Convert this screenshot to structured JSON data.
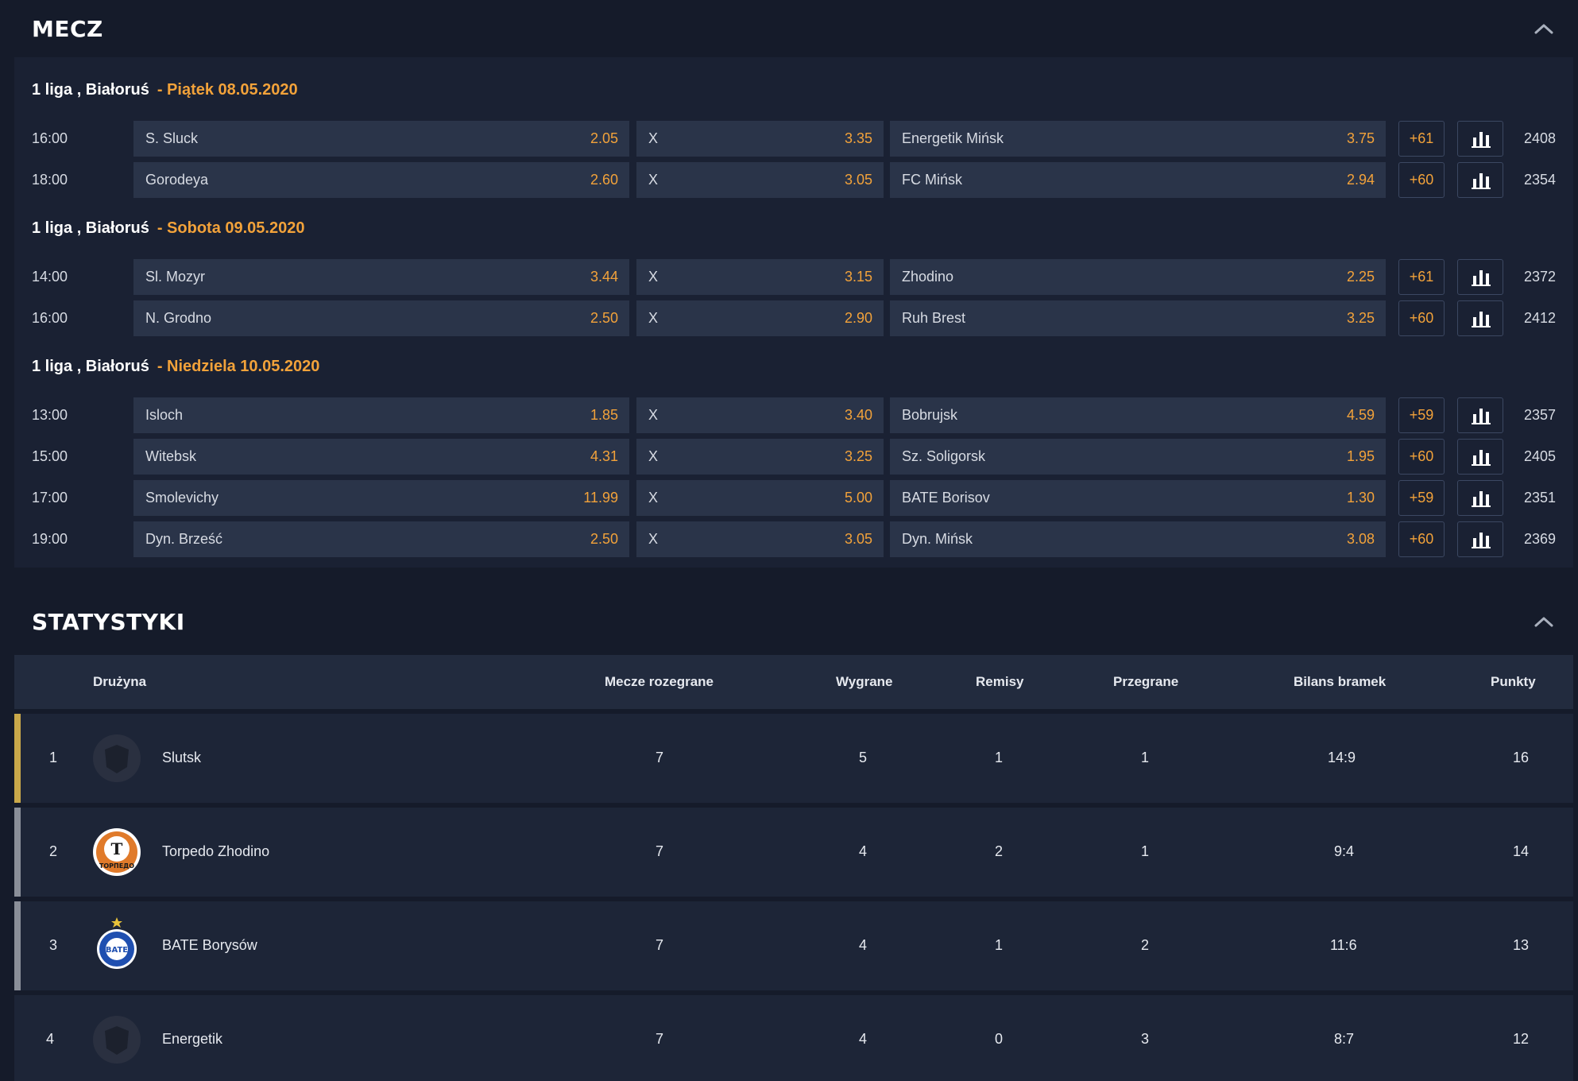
{
  "sections": {
    "match_title": "MECZ",
    "stats_title": "STATYSTYKI"
  },
  "groups": [
    {
      "league": "1 liga , Białoruś",
      "date": "- Piątek 08.05.2020",
      "matches": [
        {
          "time": "16:00",
          "home": "S. Sluck",
          "home_odd": "2.05",
          "draw": "X",
          "draw_odd": "3.35",
          "away": "Energetik Mińsk",
          "away_odd": "3.75",
          "more": "+61",
          "id": "2408"
        },
        {
          "time": "18:00",
          "home": "Gorodeya",
          "home_odd": "2.60",
          "draw": "X",
          "draw_odd": "3.05",
          "away": "FC Mińsk",
          "away_odd": "2.94",
          "more": "+60",
          "id": "2354"
        }
      ]
    },
    {
      "league": "1 liga , Białoruś",
      "date": "- Sobota 09.05.2020",
      "matches": [
        {
          "time": "14:00",
          "home": "Sl. Mozyr",
          "home_odd": "3.44",
          "draw": "X",
          "draw_odd": "3.15",
          "away": "Zhodino",
          "away_odd": "2.25",
          "more": "+61",
          "id": "2372"
        },
        {
          "time": "16:00",
          "home": "N. Grodno",
          "home_odd": "2.50",
          "draw": "X",
          "draw_odd": "2.90",
          "away": "Ruh Brest",
          "away_odd": "3.25",
          "more": "+60",
          "id": "2412"
        }
      ]
    },
    {
      "league": "1 liga , Białoruś",
      "date": "- Niedziela 10.05.2020",
      "matches": [
        {
          "time": "13:00",
          "home": "Isloch",
          "home_odd": "1.85",
          "draw": "X",
          "draw_odd": "3.40",
          "away": "Bobrujsk",
          "away_odd": "4.59",
          "more": "+59",
          "id": "2357"
        },
        {
          "time": "15:00",
          "home": "Witebsk",
          "home_odd": "4.31",
          "draw": "X",
          "draw_odd": "3.25",
          "away": "Sz. Soligorsk",
          "away_odd": "1.95",
          "more": "+60",
          "id": "2405"
        },
        {
          "time": "17:00",
          "home": "Smolevichy",
          "home_odd": "11.99",
          "draw": "X",
          "draw_odd": "5.00",
          "away": "BATE Borisov",
          "away_odd": "1.30",
          "more": "+59",
          "id": "2351"
        },
        {
          "time": "19:00",
          "home": "Dyn. Brześć",
          "home_odd": "2.50",
          "draw": "X",
          "draw_odd": "3.05",
          "away": "Dyn. Mińsk",
          "away_odd": "3.08",
          "more": "+60",
          "id": "2369"
        }
      ]
    }
  ],
  "table": {
    "headers": {
      "team": "Drużyna",
      "played": "Mecze rozegrane",
      "won": "Wygrane",
      "draws": "Remisy",
      "lost": "Przegrane",
      "goals": "Bilans bramek",
      "points": "Punkty"
    },
    "rows": [
      {
        "pos": "1",
        "team": "Slutsk",
        "played": "7",
        "won": "5",
        "draws": "1",
        "lost": "1",
        "goals": "14:9",
        "points": "16",
        "bar_color": "#c9a84a",
        "logo": "placeholder-crest"
      },
      {
        "pos": "2",
        "team": "Torpedo Zhodino",
        "played": "7",
        "won": "4",
        "draws": "2",
        "lost": "1",
        "goals": "9:4",
        "points": "14",
        "bar_color": "#8a8f99",
        "logo": "torpedo-crest",
        "logo_text": "Т",
        "logo_caption": "ТОРПЕДО"
      },
      {
        "pos": "3",
        "team": "BATE Borysów",
        "played": "7",
        "won": "4",
        "draws": "1",
        "lost": "2",
        "goals": "11:6",
        "points": "13",
        "bar_color": "#8a8f99",
        "logo": "bate-crest",
        "logo_text": "BATE"
      },
      {
        "pos": "4",
        "team": "Energetik",
        "played": "7",
        "won": "4",
        "draws": "0",
        "lost": "3",
        "goals": "8:7",
        "points": "12",
        "bar_color": "#1d2537",
        "logo": "placeholder-crest"
      }
    ]
  },
  "colors": {
    "accent": "#f2a23a",
    "background": "#151b2a",
    "panel": "#1a2133",
    "button": "#2a3449"
  }
}
